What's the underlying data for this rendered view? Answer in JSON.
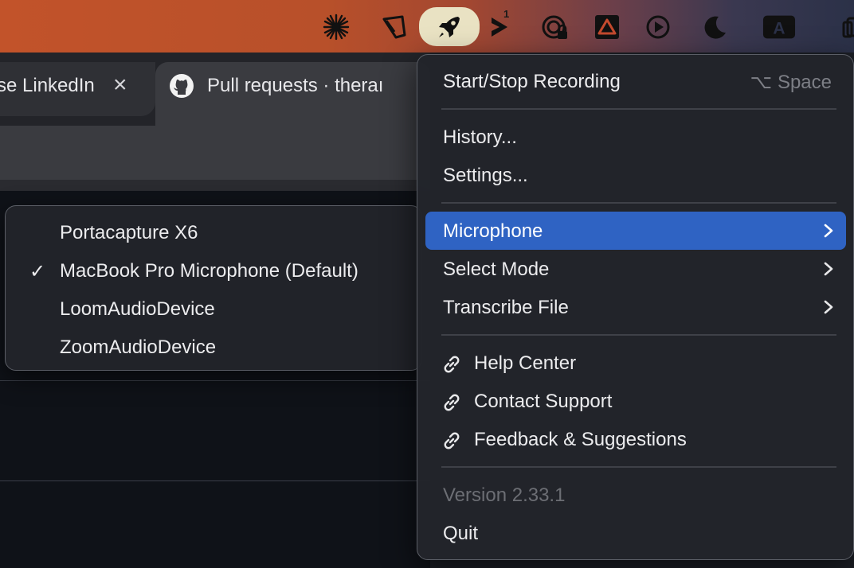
{
  "menubar": {
    "icons": [
      "asterisk-icon",
      "tag-icon",
      "rocket-icon",
      "chevron-right-icon",
      "privacy-lock-icon",
      "drive-icon",
      "play-circle-icon",
      "moon-icon",
      "a-badge-icon",
      "window-icon"
    ],
    "badge": "1"
  },
  "browser": {
    "tab1_label": "se LinkedIn",
    "tab2_label": "Pull requests · theraı"
  },
  "submenu": {
    "items": [
      {
        "label": "Portacapture X6",
        "checked": false
      },
      {
        "label": "MacBook Pro Microphone (Default)",
        "checked": true
      },
      {
        "label": "LoomAudioDevice",
        "checked": false
      },
      {
        "label": "ZoomAudioDevice",
        "checked": false
      }
    ],
    "check_glyph": "✓"
  },
  "menu": {
    "start_stop": "Start/Stop Recording",
    "shortcut": "⌥ Space",
    "history": "History...",
    "settings": "Settings...",
    "microphone": "Microphone",
    "select_mode": "Select Mode",
    "transcribe_file": "Transcribe File",
    "help_center": "Help Center",
    "contact_support": "Contact Support",
    "feedback": "Feedback & Suggestions",
    "version": "Version 2.33.1",
    "quit": "Quit"
  },
  "colors": {
    "highlight": "#2f63c3",
    "menu_bg": "#23252b",
    "menubar_orange": "#c2532a"
  }
}
